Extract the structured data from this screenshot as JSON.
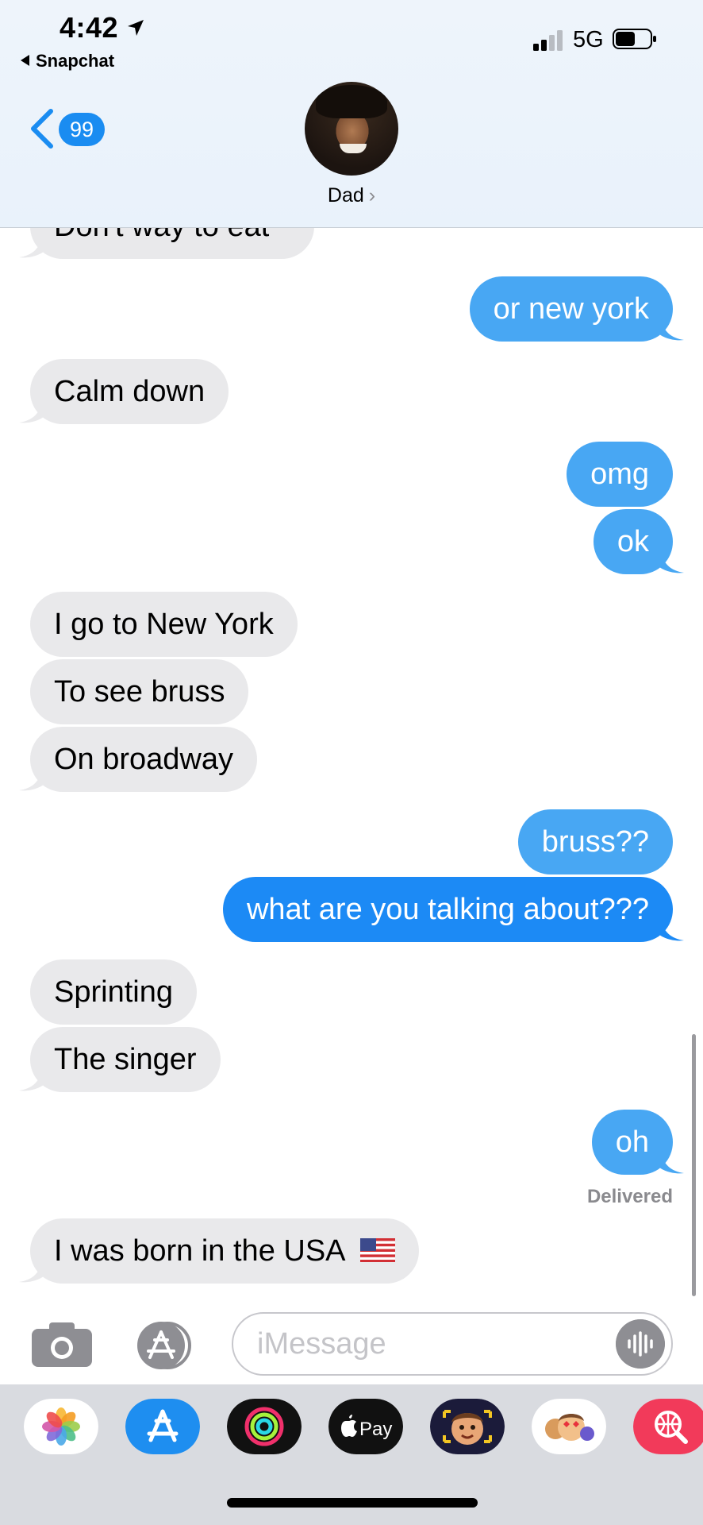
{
  "status": {
    "time": "4:42",
    "back_app": "Snapchat",
    "network": "5G"
  },
  "header": {
    "unread_count": "99",
    "contact_name": "Dad",
    "contact_chevron": "›"
  },
  "messages": {
    "m0": "Don't way to eat",
    "m1": "or new york",
    "m2": "Calm down",
    "m3": "omg",
    "m4": "ok",
    "m5": "I go to New York",
    "m6": "To see bruss",
    "m7": "On broadway",
    "m8": "bruss??",
    "m9": "what are you talking about???",
    "m10": "Sprinting",
    "m11": "The singer",
    "m12": "oh",
    "m13": "I was born in the USA"
  },
  "delivered_label": "Delivered",
  "input": {
    "placeholder": "iMessage"
  },
  "app_drawer": [
    "Photos",
    "App Store",
    "Activity",
    "Apple Pay",
    "Memoji Stickers",
    "Memoji",
    "Web Search"
  ],
  "colors": {
    "incoming_bubble": "#e9e9eb",
    "outgoing_bubble": "#48a7f3",
    "badge": "#1a8cf1",
    "drawer_bg": "#d9dbe0"
  }
}
